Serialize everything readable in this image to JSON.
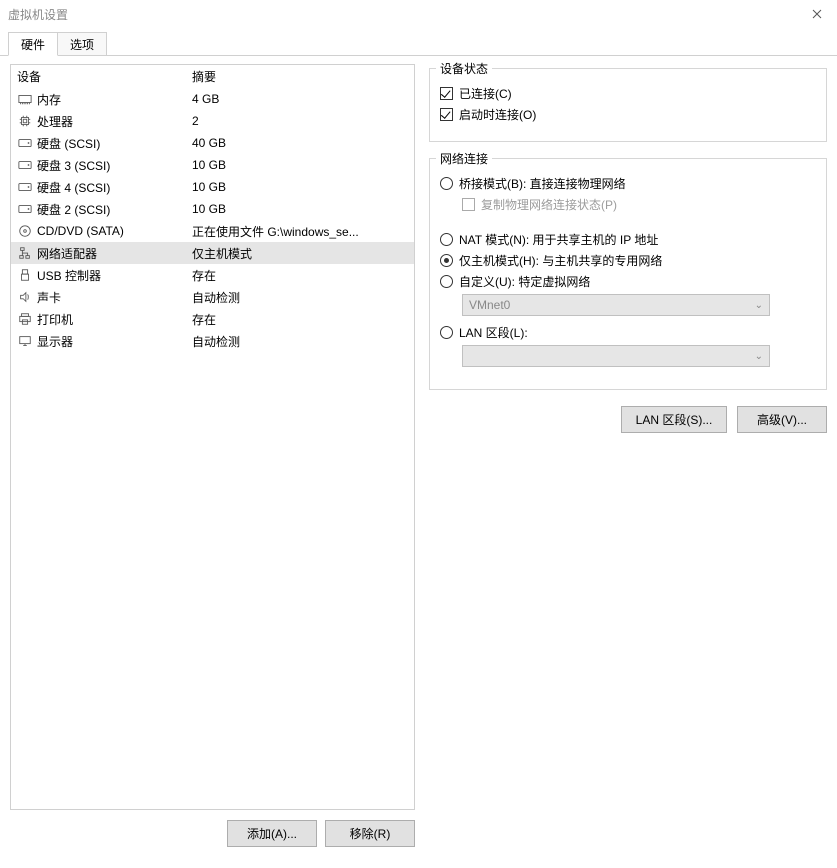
{
  "window": {
    "title": "虚拟机设置"
  },
  "tabs": {
    "hardware": "硬件",
    "options": "选项"
  },
  "device_header": {
    "device": "设备",
    "summary": "摘要"
  },
  "devices": [
    {
      "icon": "memory",
      "name": "内存",
      "summary": "4 GB"
    },
    {
      "icon": "cpu",
      "name": "处理器",
      "summary": "2"
    },
    {
      "icon": "disk",
      "name": "硬盘 (SCSI)",
      "summary": "40 GB"
    },
    {
      "icon": "disk",
      "name": "硬盘 3 (SCSI)",
      "summary": "10 GB"
    },
    {
      "icon": "disk",
      "name": "硬盘 4 (SCSI)",
      "summary": "10 GB"
    },
    {
      "icon": "disk",
      "name": "硬盘 2 (SCSI)",
      "summary": "10 GB"
    },
    {
      "icon": "cd",
      "name": "CD/DVD (SATA)",
      "summary": "正在使用文件 G:\\windows_se..."
    },
    {
      "icon": "network",
      "name": "网络适配器",
      "summary": "仅主机模式",
      "selected": true
    },
    {
      "icon": "usb",
      "name": "USB 控制器",
      "summary": "存在"
    },
    {
      "icon": "sound",
      "name": "声卡",
      "summary": "自动检测"
    },
    {
      "icon": "printer",
      "name": "打印机",
      "summary": "存在"
    },
    {
      "icon": "display",
      "name": "显示器",
      "summary": "自动检测"
    }
  ],
  "left_buttons": {
    "add": "添加(A)...",
    "remove": "移除(R)"
  },
  "device_status": {
    "title": "设备状态",
    "connected": "已连接(C)",
    "connect_on_power": "启动时连接(O)"
  },
  "network_connection": {
    "title": "网络连接",
    "bridged": "桥接模式(B): 直接连接物理网络",
    "replicate": "复制物理网络连接状态(P)",
    "nat": "NAT 模式(N): 用于共享主机的 IP 地址",
    "hostonly": "仅主机模式(H): 与主机共享的专用网络",
    "custom": "自定义(U): 特定虚拟网络",
    "custom_value": "VMnet0",
    "lan_segment": "LAN 区段(L):",
    "lan_value": ""
  },
  "right_buttons": {
    "lan_segments": "LAN 区段(S)...",
    "advanced": "高级(V)..."
  }
}
